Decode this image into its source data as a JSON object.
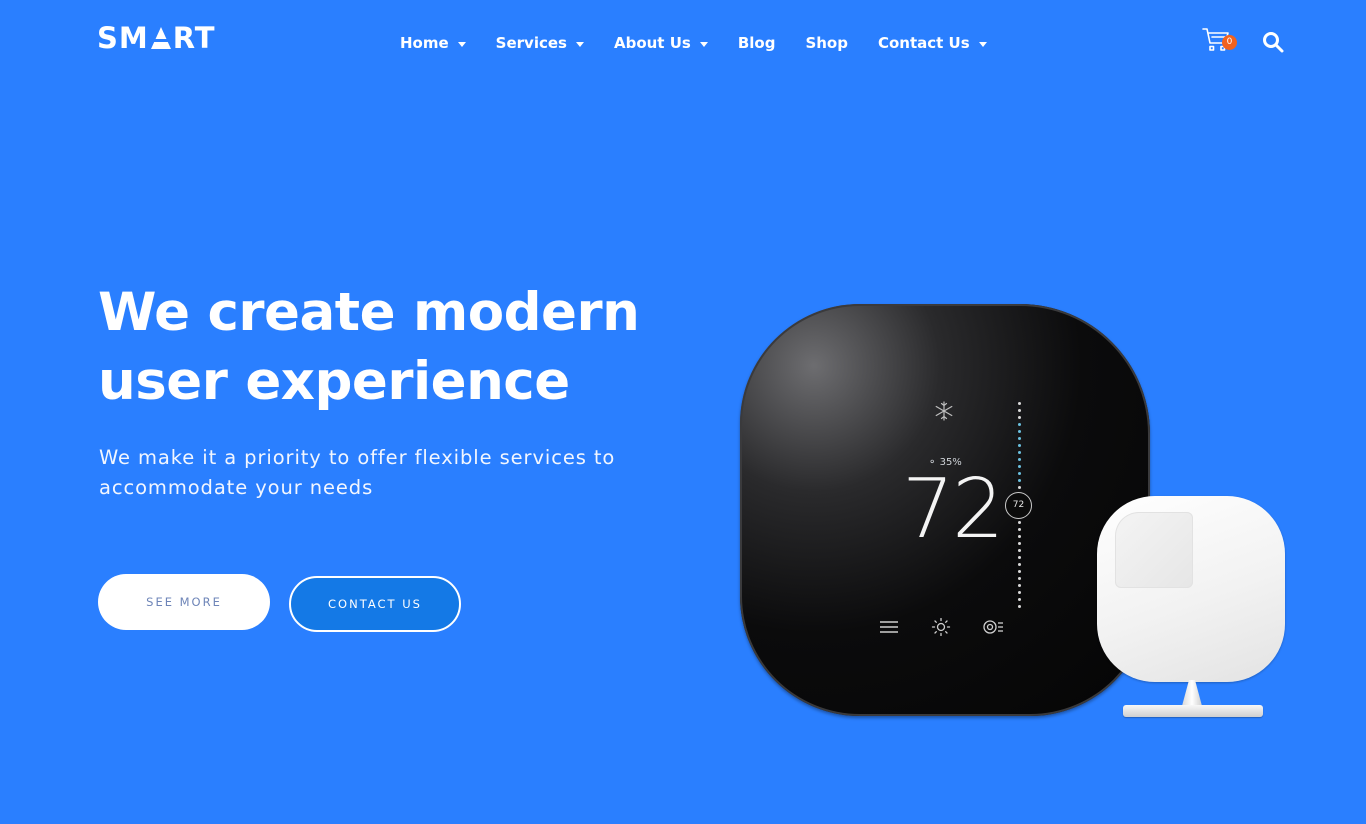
{
  "brand": {
    "logo_text_left": "SM",
    "logo_text_right": "RT"
  },
  "nav": {
    "items": [
      {
        "label": "Home",
        "has_dropdown": true
      },
      {
        "label": "Services",
        "has_dropdown": true
      },
      {
        "label": "About Us",
        "has_dropdown": true
      },
      {
        "label": "Blog",
        "has_dropdown": false
      },
      {
        "label": "Shop",
        "has_dropdown": false
      },
      {
        "label": "Contact Us",
        "has_dropdown": true
      }
    ]
  },
  "header_actions": {
    "cart_icon": "shopping-cart-icon",
    "cart_count": "0",
    "search_icon": "search-icon"
  },
  "hero": {
    "title": "We create modern user experience",
    "subtitle": "We make it a priority to offer flexible services to accommodate your needs",
    "primary_button": "SEE MORE",
    "secondary_button": "CONTACT US"
  },
  "product_display": {
    "humidity": "35%",
    "temperature": "72",
    "set_point": "72",
    "mode_icon": "snowflake-icon",
    "controls": [
      "menu-icon",
      "sun-icon",
      "settings-icon"
    ]
  },
  "colors": {
    "background": "#2a7fff",
    "secondary_button_bg": "#1479e6",
    "cart_badge": "#f2621e",
    "see_more_text": "#6e85b8"
  }
}
